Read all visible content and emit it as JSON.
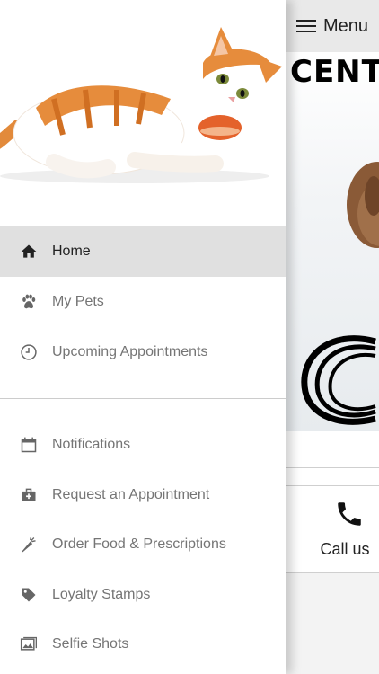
{
  "header": {
    "menu_label": "Menu"
  },
  "hero": {
    "brand_partial": "CENT"
  },
  "actions": {
    "call_label": "Call us"
  },
  "drawer": {
    "items": [
      {
        "label": "Home",
        "icon": "home-icon"
      },
      {
        "label": "My Pets",
        "icon": "paw-icon"
      },
      {
        "label": "Upcoming Appointments",
        "icon": "clock-icon"
      },
      {
        "label": "Notifications",
        "icon": "calendar-icon"
      },
      {
        "label": "Request an Appointment",
        "icon": "medical-bag-icon"
      },
      {
        "label": "Order Food & Prescriptions",
        "icon": "carrot-icon"
      },
      {
        "label": "Loyalty Stamps",
        "icon": "tag-icon"
      },
      {
        "label": "Selfie Shots",
        "icon": "photos-icon"
      }
    ]
  },
  "colors": {
    "drawer_active_bg": "#e0e0e0",
    "topbar_bg": "#e9e9e9",
    "text_muted": "#757575",
    "text_dark": "#222222"
  }
}
